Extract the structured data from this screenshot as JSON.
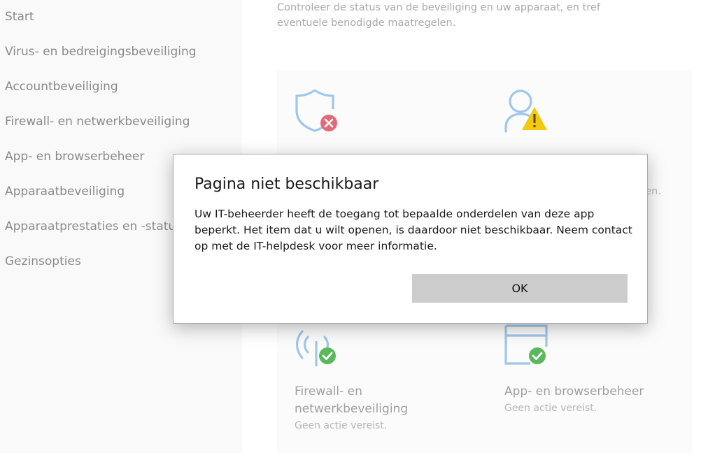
{
  "sidebar": {
    "items": [
      {
        "label": "Start"
      },
      {
        "label": "Virus- en bedreigingsbeveiliging"
      },
      {
        "label": "Accountbeveiliging"
      },
      {
        "label": "Firewall- en netwerkbeveiliging"
      },
      {
        "label": "App- en browserbeheer"
      },
      {
        "label": "Apparaatbeveiliging"
      },
      {
        "label": "Apparaatprestaties en -status"
      },
      {
        "label": "Gezinsopties"
      }
    ]
  },
  "main": {
    "intro": "Controleer de status van de beveiliging en uw apparaat, en tref eventuele benodigde maatregelen.",
    "account_tile_fragment": "den.",
    "tiles": [
      {
        "icon": "shield-error-icon",
        "status_color": "#e06b77"
      },
      {
        "icon": "account-warning-icon",
        "status_color": "#f2c811"
      },
      {
        "icon": "wifi-ok-icon",
        "title_line1": "Firewall- en",
        "title_line2": "netwerkbeveiliging",
        "subtitle": "Geen actie vereist.",
        "status_color": "#5cb85c"
      },
      {
        "icon": "browser-ok-icon",
        "title": "App- en browserbeheer",
        "subtitle": "Geen actie vereist.",
        "status_color": "#5cb85c"
      }
    ]
  },
  "dialog": {
    "title": "Pagina niet beschikbaar",
    "body": "Uw IT-beheerder heeft de toegang tot bepaalde onderdelen van deze app beperkt. Het item dat u wilt openen, is daardoor niet beschikbaar. Neem contact op met de IT-helpdesk voor meer informatie.",
    "ok_label": "OK"
  },
  "colors": {
    "icon_blue": "#9ec7ea",
    "error_red": "#e06b77",
    "warning_yellow": "#f2c811",
    "ok_green": "#5cb85c"
  }
}
